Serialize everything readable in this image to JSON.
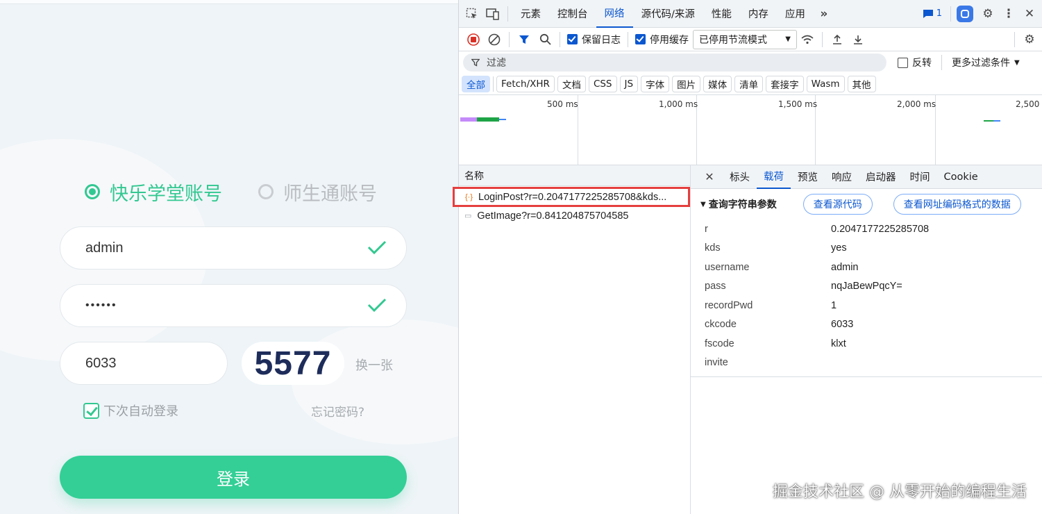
{
  "login": {
    "radio_selected": "快乐学堂账号",
    "radio_other": "师生通账号",
    "username": "admin",
    "password_mask": "••••••",
    "captcha_input": "6033",
    "captcha_image_text": "5577",
    "refresh_label": "换一张",
    "remember_label": "下次自动登录",
    "forgot_label": "忘记密码?",
    "login_button": "登录",
    "accent_color": "#33cf96"
  },
  "devtools": {
    "tabs": [
      "元素",
      "控制台",
      "网络",
      "源代码/来源",
      "性能",
      "内存",
      "应用"
    ],
    "active_tab": "网络",
    "issue_count": "1",
    "toolbar": {
      "preserve_log": "保留日志",
      "disable_cache": "停用缓存",
      "throttle": "已停用节流模式"
    },
    "filter": {
      "placeholder": "过滤",
      "invert": "反转",
      "more_filters": "更多过滤条件"
    },
    "type_filters": [
      "全部",
      "Fetch/XHR",
      "文档",
      "CSS",
      "JS",
      "字体",
      "图片",
      "媒体",
      "清单",
      "套接字",
      "Wasm",
      "其他"
    ],
    "timeline_labels": [
      "500 ms",
      "1,000 ms",
      "1,500 ms",
      "2,000 ms",
      "2,500"
    ],
    "list": {
      "header": "名称",
      "requests": [
        {
          "name": "LoginPost?r=0.2047177225285708&kds...",
          "type": "xhr"
        },
        {
          "name": "GetImage?r=0.841204875704585",
          "type": "img"
        }
      ]
    },
    "detail": {
      "tabs": [
        "标头",
        "载荷",
        "预览",
        "响应",
        "启动器",
        "时间",
        "Cookie"
      ],
      "active_tab": "载荷",
      "section_title": "查询字符串参数",
      "view_source": "查看源代码",
      "view_url_encoded": "查看网址编码格式的数据",
      "params": [
        {
          "key": "r",
          "value": "0.2047177225285708"
        },
        {
          "key": "kds",
          "value": "yes"
        },
        {
          "key": "username",
          "value": "admin"
        },
        {
          "key": "pass",
          "value": "nqJaBewPqcY="
        },
        {
          "key": "recordPwd",
          "value": "1"
        },
        {
          "key": "ckcode",
          "value": "6033"
        },
        {
          "key": "fscode",
          "value": "klxt"
        },
        {
          "key": "invite",
          "value": ""
        }
      ]
    }
  },
  "watermark": "掘金技术社区 @ 从零开始的编程生活"
}
